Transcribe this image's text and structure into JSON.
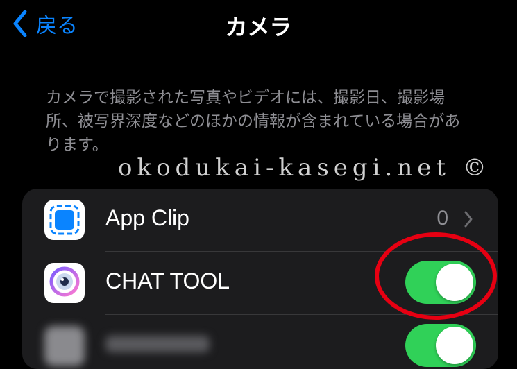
{
  "nav": {
    "back_label": "戻る",
    "title": "カメラ"
  },
  "description": "カメラで撮影された写真やビデオには、撮影日、撮影場所、被写界深度などのほかの情報が含まれている場合があります。",
  "watermark": "okodukai-kasegi.net ©",
  "rows": [
    {
      "label": "App Clip",
      "value": "0",
      "icon": "app-clip-icon"
    },
    {
      "label": "CHAT TOOL",
      "toggle_on": true,
      "icon": "camera-app-icon"
    },
    {
      "label": "",
      "toggle_on": true,
      "blurred": true,
      "icon": "blurred-app-icon"
    }
  ],
  "colors": {
    "background": "#000000",
    "group_background": "#1c1c1e",
    "accent_blue": "#0a84ff",
    "toggle_on": "#30d158",
    "secondary_text": "#8e8e93",
    "annotation_red": "#e60012"
  }
}
